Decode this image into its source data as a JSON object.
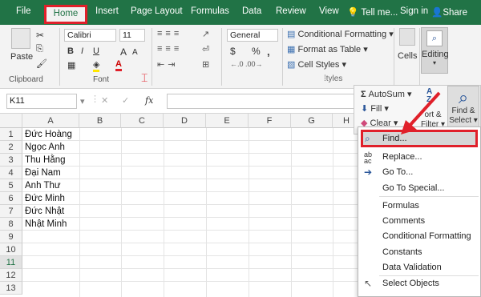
{
  "tabs": {
    "file": "File",
    "home": "Home",
    "insert": "Insert",
    "page_layout": "Page Layout",
    "formulas": "Formulas",
    "data": "Data",
    "review": "Review",
    "view": "View",
    "tell_me": "Tell me...",
    "sign_in": "Sign in",
    "share": "Share"
  },
  "clipboard": {
    "paste": "Paste",
    "label": "Clipboard"
  },
  "font": {
    "name": "Calibri",
    "size": "11",
    "label": "Font",
    "bold": "B",
    "italic": "I",
    "underline": "U"
  },
  "number": {
    "format": "General",
    "currency": "$",
    "percent": "%",
    "comma": ","
  },
  "styles": {
    "conditional": "Conditional Formatting",
    "format_table": "Format as Table",
    "cell_styles": "Cell Styles",
    "label_fragment": "tyles"
  },
  "cells": {
    "label": "Cells"
  },
  "editing": {
    "label": "Editing",
    "autosum": "AutoSum",
    "fill": "Fill",
    "clear": "Clear",
    "sort_filter_1": "ort &",
    "sort_filter_2": "Filter",
    "find_select_1": "Find &",
    "find_select_2": "Select"
  },
  "formula_bar": {
    "name_box": "K11",
    "fx": "fx"
  },
  "columns": [
    "A",
    "B",
    "C",
    "D",
    "E",
    "F",
    "G",
    "H"
  ],
  "rows": [
    "1",
    "2",
    "3",
    "4",
    "5",
    "6",
    "7",
    "8",
    "9",
    "10",
    "11",
    "12",
    "13"
  ],
  "cells_col_a": [
    "Đức Hoàng",
    "Ngọc Anh",
    "Thu Hằng",
    "Đại Nam",
    "Anh Thư",
    "Đức Minh",
    "Đức Nhật",
    "Nhật Minh"
  ],
  "menu": {
    "find": "Find...",
    "replace": "Replace...",
    "go_to": "Go To...",
    "go_to_special": "Go To Special...",
    "formulas": "Formulas",
    "comments": "Comments",
    "conditional_formatting": "Conditional Formatting",
    "constants": "Constants",
    "data_validation": "Data Validation",
    "select_objects": "Select Objects"
  },
  "colors": {
    "accent": "#217346",
    "highlight": "#e0202a"
  }
}
